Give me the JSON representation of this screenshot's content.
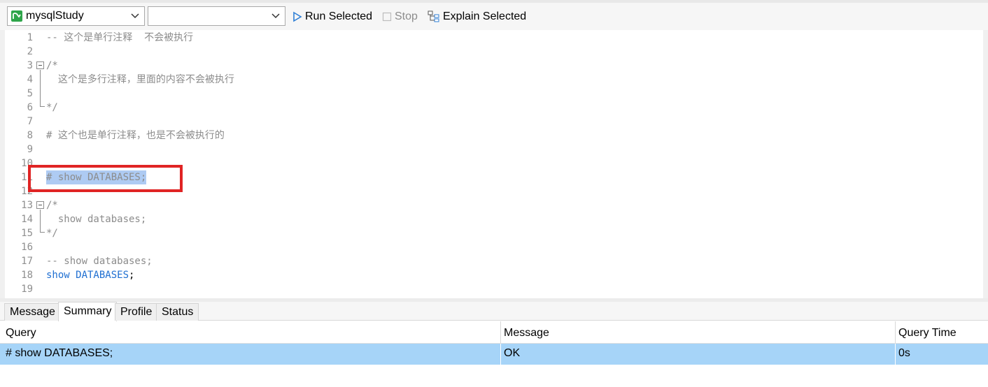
{
  "toolbar": {
    "connection_value": "mysqlStudy",
    "database_value": "",
    "run_selected_label": "Run Selected",
    "stop_label": "Stop",
    "explain_selected_label": "Explain Selected"
  },
  "editor": {
    "lines": [
      {
        "num": "1",
        "text": "-- 这个是单行注释  不会被执行"
      },
      {
        "num": "2",
        "text": ""
      },
      {
        "num": "3",
        "text": "/*"
      },
      {
        "num": "4",
        "text": "  这个是多行注释，里面的内容不会被执行"
      },
      {
        "num": "5",
        "text": ""
      },
      {
        "num": "6",
        "text": "*/"
      },
      {
        "num": "7",
        "text": ""
      },
      {
        "num": "8",
        "text": "# 这个也是单行注释，也是不会被执行的"
      },
      {
        "num": "9",
        "text": ""
      },
      {
        "num": "10",
        "text": ""
      },
      {
        "num": "11",
        "text": "# show DATABASES;"
      },
      {
        "num": "12",
        "text": ""
      },
      {
        "num": "13",
        "text": "/*"
      },
      {
        "num": "14",
        "text": "  show databases;"
      },
      {
        "num": "15",
        "text": "*/"
      },
      {
        "num": "16",
        "text": ""
      },
      {
        "num": "17",
        "text": "-- show databases;"
      },
      {
        "num": "18",
        "keyword": "show DATABASES",
        "punct": ";"
      },
      {
        "num": "19",
        "text": ""
      }
    ]
  },
  "bottom_panel": {
    "tabs": [
      {
        "label": "Message"
      },
      {
        "label": "Summary"
      },
      {
        "label": "Profile"
      },
      {
        "label": "Status"
      }
    ],
    "active_tab": "Summary",
    "columns": [
      "Query",
      "Message",
      "Query Time"
    ],
    "rows": [
      {
        "query": "# show DATABASES;",
        "message": "OK",
        "time": "0s"
      }
    ]
  },
  "colors": {
    "selection": "#aecbf3",
    "annotation_box": "#e02424",
    "row_selected": "#a6d4f8",
    "keyword": "#1f6fd1",
    "comment": "#8c8c8c"
  },
  "icons": {
    "connection": "mysql-connection-icon",
    "run": "play-triangle-icon",
    "stop": "stop-square-icon",
    "explain": "explain-tree-icon"
  }
}
